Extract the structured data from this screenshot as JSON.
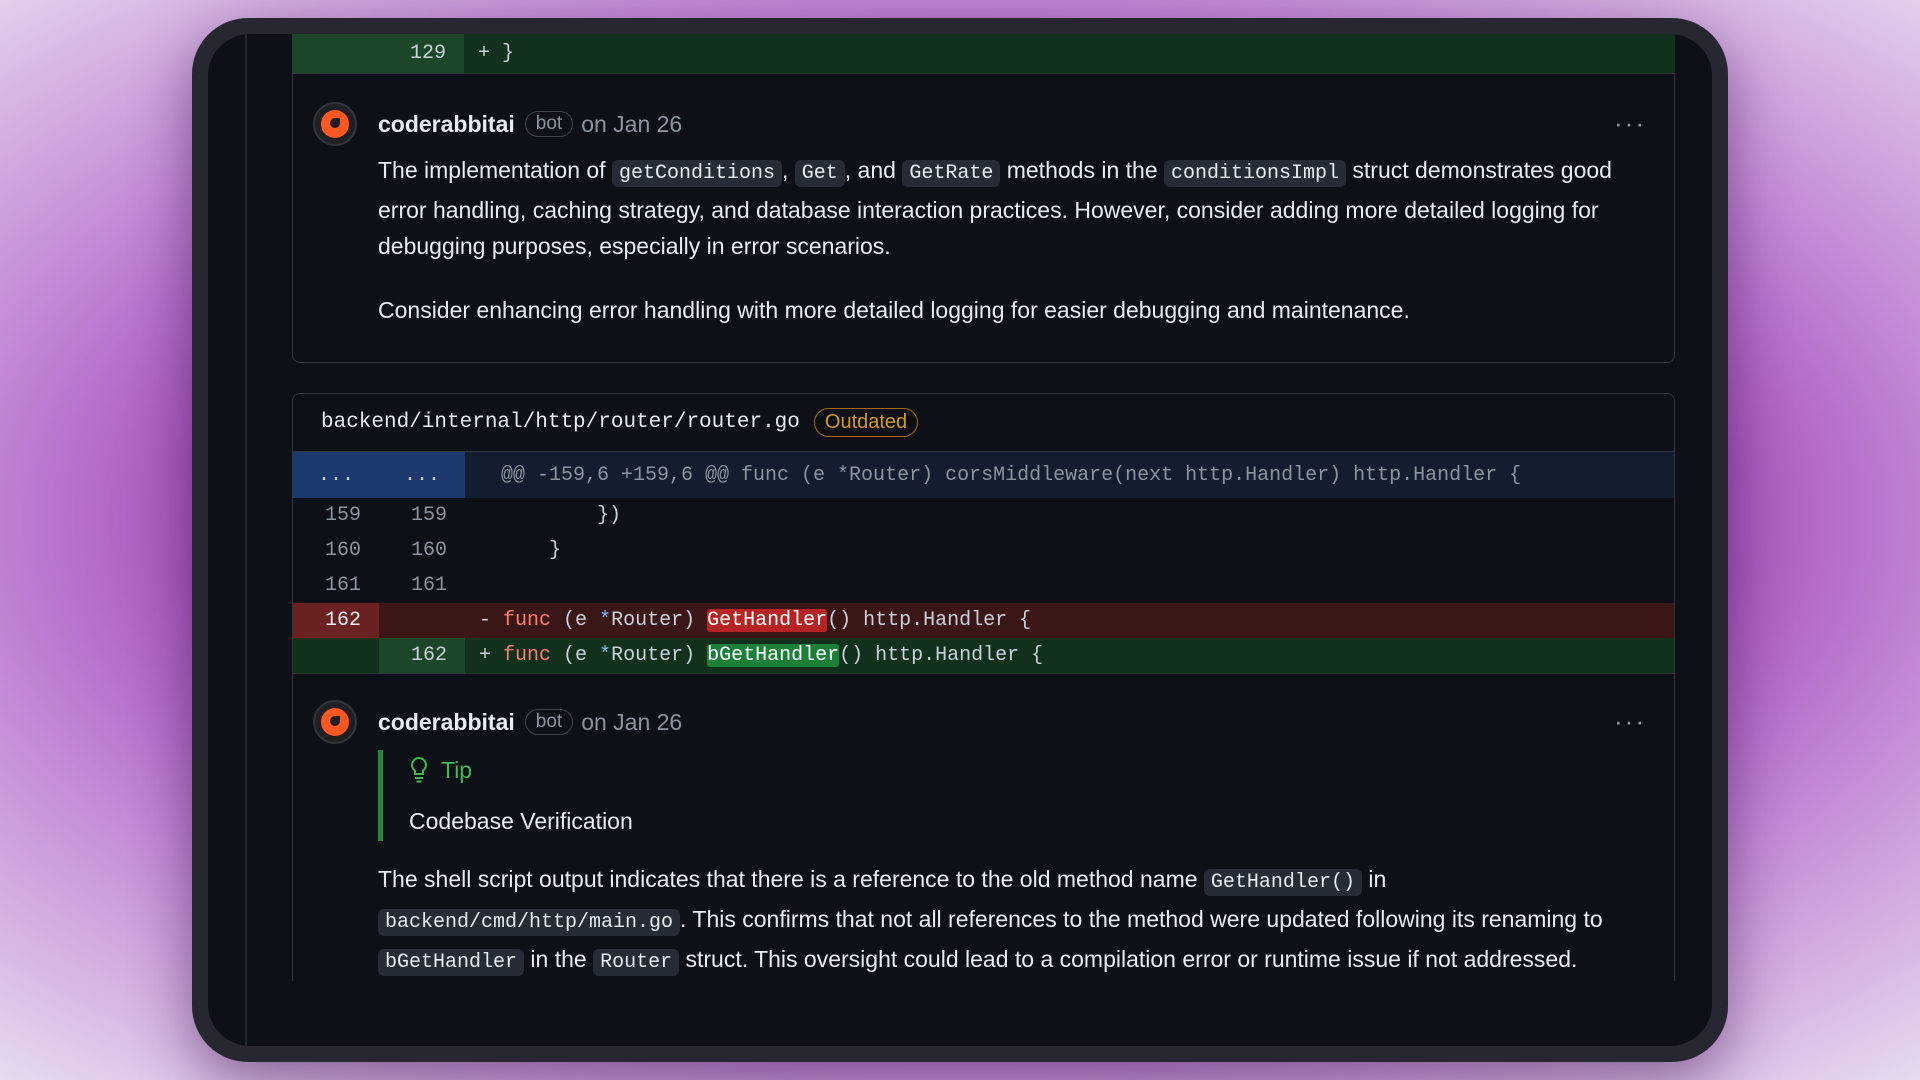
{
  "top_diff": {
    "line_new": "129",
    "code": "+ }"
  },
  "comment1": {
    "author": "coderabbitai",
    "badge": "bot",
    "date": "on Jan 26",
    "more": "···",
    "p1": {
      "t1": "The implementation of ",
      "c1": "getConditions",
      "t2": ", ",
      "c2": "Get",
      "t3": ", and ",
      "c3": "GetRate",
      "t4": " methods in the ",
      "c4": "conditionsImpl",
      "t5": " struct demonstrates good error handling, caching strategy, and database interaction practices. However, consider adding more detailed logging for debugging purposes, especially in error scenarios."
    },
    "p2": "Consider enhancing error handling with more detailed logging for easier debugging and maintenance."
  },
  "file": {
    "path": "backend/internal/http/router/router.go",
    "status": "Outdated",
    "hunk": {
      "old": "...",
      "new": "...",
      "header": "@@ -159,6 +159,6 @@ func (e *Router) corsMiddleware(next http.Handler) http.Handler {"
    },
    "lines": [
      {
        "old": "159",
        "new": "159",
        "code": "        })"
      },
      {
        "old": "160",
        "new": "160",
        "code": "    }"
      },
      {
        "old": "161",
        "new": "161",
        "code": ""
      }
    ],
    "del": {
      "old": "162",
      "sign": "- ",
      "kw": "func",
      "pre": " (e ",
      "star": "*",
      "recv": "Router) ",
      "name": "GetHandler",
      "post": "() http.Handler {"
    },
    "add": {
      "new": "162",
      "sign": "+ ",
      "kw": "func",
      "pre": " (e ",
      "star": "*",
      "recv": "Router) ",
      "name": "bGetHandler",
      "post": "() http.Handler {"
    }
  },
  "comment2": {
    "author": "coderabbitai",
    "badge": "bot",
    "date": "on Jan 26",
    "more": "···",
    "tip_title": "Tip",
    "tip_body": "Codebase Verification",
    "p1": {
      "t1": "The shell script output indicates that there is a reference to the old method name ",
      "c1": "GetHandler()",
      "t2": " in ",
      "c2": "backend/cmd/http/main.go",
      "t3": ". This confirms that not all references to the method were updated following its renaming to ",
      "c3": "bGetHandler",
      "t4": " in the ",
      "c4": "Router",
      "t5": " struct. This oversight could lead to a compilation error or runtime issue if not addressed."
    }
  }
}
